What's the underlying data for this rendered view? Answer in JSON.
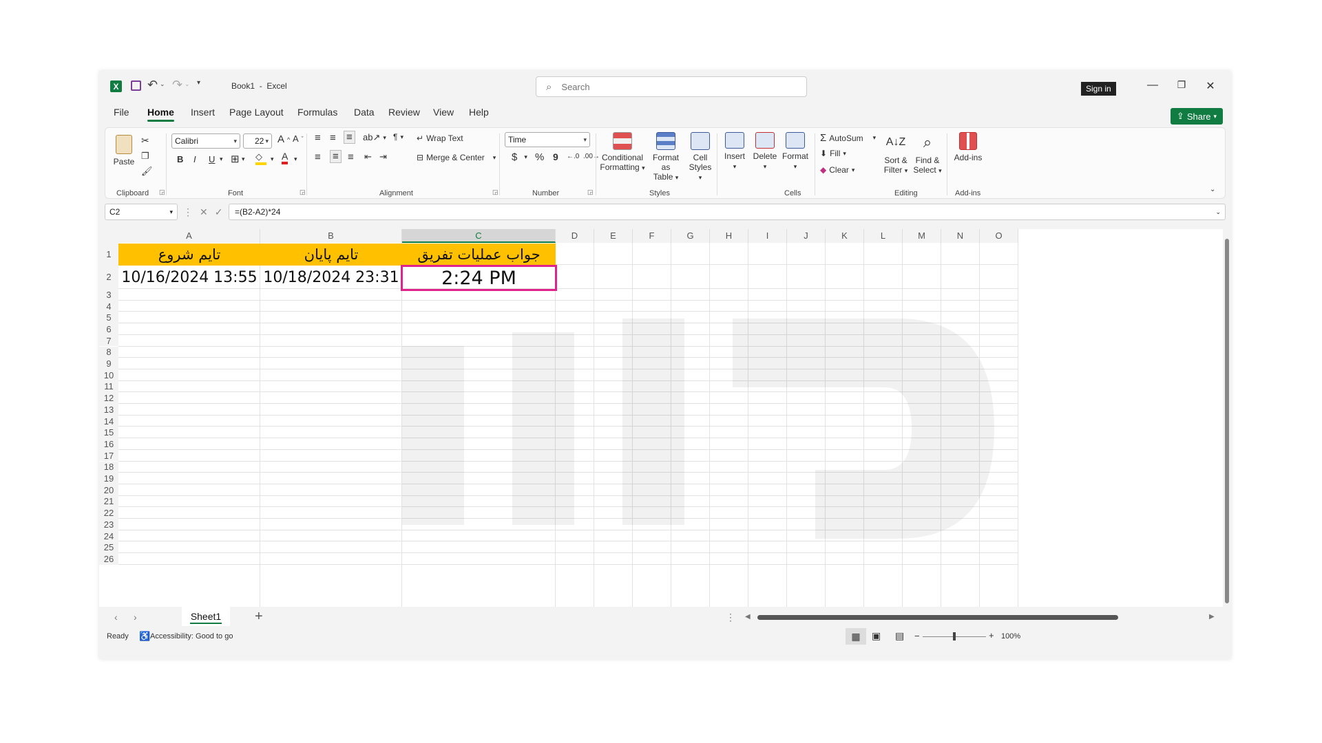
{
  "app": {
    "logo_letter": "X",
    "doc_name": "Book1",
    "app_name": "Excel",
    "search_placeholder": "Search",
    "sign_in": "Sign in",
    "share": "Share"
  },
  "menu": [
    "File",
    "Home",
    "Insert",
    "Page Layout",
    "Formulas",
    "Data",
    "Review",
    "View",
    "Help"
  ],
  "active_menu": "Home",
  "ribbon": {
    "clipboard": {
      "paste": "Paste",
      "label": "Clipboard"
    },
    "font": {
      "name": "Calibri",
      "size": "22",
      "bold": "B",
      "italic": "I",
      "underline": "U",
      "label": "Font"
    },
    "alignment": {
      "wrap_text": "Wrap Text",
      "merge_center": "Merge & Center",
      "label": "Alignment"
    },
    "number": {
      "format": "Time",
      "currency": "$",
      "percent": "%",
      "comma": "9",
      "label": "Number"
    },
    "styles": {
      "conditional": "Conditional",
      "conditional2": "Formatting",
      "format_as": "Format as",
      "format_as2": "Table",
      "cell": "Cell",
      "cell2": "Styles",
      "label": "Styles"
    },
    "cells": {
      "insert": "Insert",
      "delete": "Delete",
      "format": "Format",
      "label": "Cells"
    },
    "editing": {
      "autosum": "AutoSum",
      "fill": "Fill",
      "clear": "Clear",
      "sort": "Sort &",
      "sort2": "Filter",
      "find": "Find &",
      "find2": "Select",
      "label": "Editing"
    },
    "addins": {
      "addins": "Add-ins",
      "label": "Add-ins"
    }
  },
  "formula_bar": {
    "name_box": "C2",
    "fx": "fx",
    "formula": "=(B2-A2)*24"
  },
  "sheet": {
    "columns": [
      "A",
      "B",
      "C",
      "D",
      "E",
      "F",
      "G",
      "H",
      "I",
      "J",
      "K",
      "L",
      "M",
      "N",
      "O"
    ],
    "rows": [
      "1",
      "2",
      "3",
      "4",
      "5",
      "6",
      "7",
      "8",
      "9",
      "10",
      "11",
      "12",
      "13",
      "14",
      "15",
      "16",
      "17",
      "18",
      "19",
      "20",
      "21",
      "22",
      "23",
      "24",
      "25",
      "26"
    ],
    "cells": {
      "A1": "تایم شروع",
      "B1": "تایم پایان",
      "C1": "جواب عملیات تفریق",
      "A2": "10/16/2024 13:55",
      "B2": "10/18/2024 23:31",
      "C2": "2:24 PM"
    },
    "selected_cell": "C2",
    "header_color": "#ffc000",
    "selection_color": "#e0228b"
  },
  "tabs": {
    "sheet1": "Sheet1",
    "add": "+"
  },
  "status": {
    "ready": "Ready",
    "accessibility": "Accessibility: Good to go",
    "zoom": "100%"
  },
  "colors": {
    "accent": "#107c41"
  }
}
